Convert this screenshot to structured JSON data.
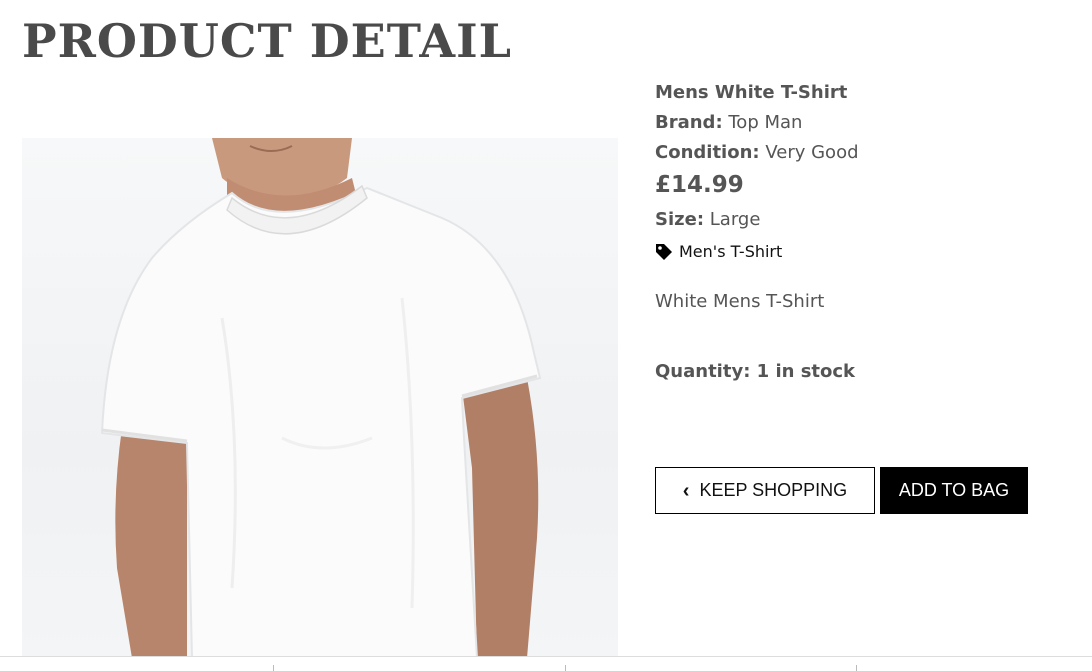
{
  "page": {
    "title": "PRODUCT DETAIL"
  },
  "product": {
    "image_alt": "Mens White T-Shirt",
    "name": "Mens White T-Shirt",
    "brand_label": "Brand:",
    "brand_value": "Top Man",
    "condition_label": "Condition:",
    "condition_value": "Very Good",
    "price": "£14.99",
    "size_label": "Size:",
    "size_value": "Large",
    "category": "Men's T-Shirt",
    "category_icon": "tag-icon",
    "description": "White Mens T-Shirt",
    "quantity": "Quantity: 1 in stock"
  },
  "actions": {
    "keep_shopping_label": "KEEP SHOPPING",
    "keep_shopping_icon": "chevron-left-icon",
    "add_to_bag_label": "ADD TO BAG"
  },
  "colors": {
    "text": "#555555",
    "button_dark": "#000000",
    "button_light": "#ffffff"
  }
}
